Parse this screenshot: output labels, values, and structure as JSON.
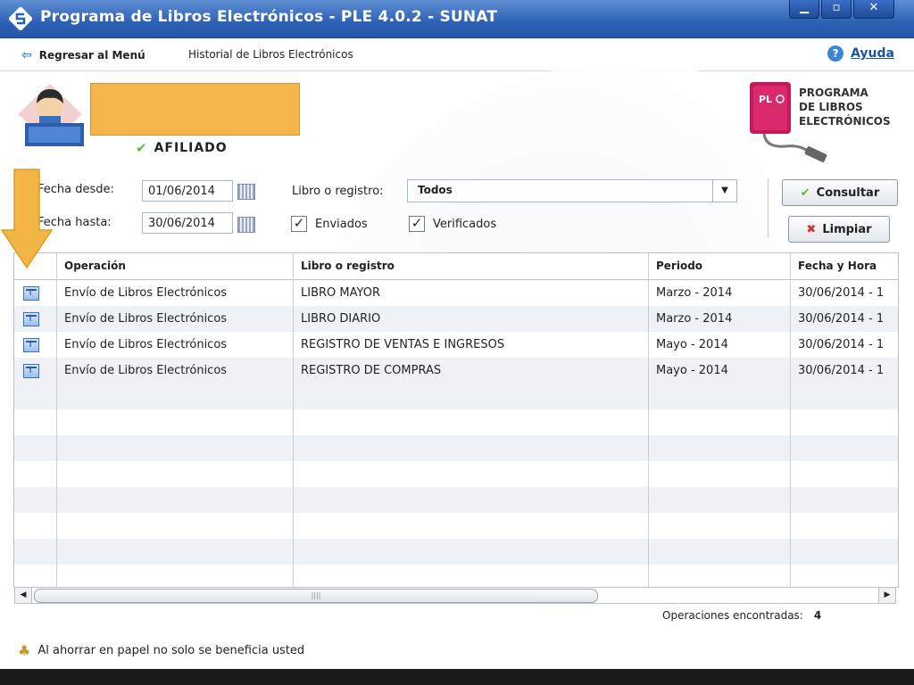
{
  "window": {
    "title": "Programa de Libros Electrónicos - PLE 4.0.2 - SUNAT",
    "minimize": "▁",
    "maximize": "▫",
    "close": "✕"
  },
  "nav": {
    "back_label": "Regresar al Menú",
    "current_label": "Historial de Libros Electrónicos",
    "help_label": "Ayuda"
  },
  "user": {
    "status": "AFILIADO"
  },
  "logo": {
    "line1": "PROGRAMA",
    "line2": "DE LIBROS",
    "line3": "ELECTRÓNICOS",
    "badge": "PL"
  },
  "filters": {
    "fecha_desde_label": "Fecha desde:",
    "fecha_desde": "01/06/2014",
    "fecha_hasta_label": "Fecha hasta:",
    "fecha_hasta": "30/06/2014",
    "libro_label": "Libro o registro:",
    "libro_value": "Todos",
    "enviados_label": "Enviados",
    "verificados_label": "Verificados"
  },
  "buttons": {
    "consultar": "Consultar",
    "limpiar": "Limpiar"
  },
  "table": {
    "columns": [
      "Operación",
      "Libro o registro",
      "Periodo",
      "Fecha y Hora"
    ],
    "rows": [
      {
        "operacion": "Envío de Libros Electrónicos",
        "libro": "LIBRO MAYOR",
        "periodo": "Marzo  -  2014",
        "fecha": "30/06/2014 - 1"
      },
      {
        "operacion": "Envío de Libros Electrónicos",
        "libro": "LIBRO DIARIO",
        "periodo": "Marzo  -  2014",
        "fecha": "30/06/2014 - 1"
      },
      {
        "operacion": "Envío de Libros Electrónicos",
        "libro": "REGISTRO DE VENTAS E INGRESOS",
        "periodo": "Mayo  -  2014",
        "fecha": "30/06/2014 - 1"
      },
      {
        "operacion": "Envío de Libros Electrónicos",
        "libro": "REGISTRO DE COMPRAS",
        "periodo": "Mayo  -  2014",
        "fecha": "30/06/2014 - 1"
      }
    ]
  },
  "status": {
    "found_label": "Operaciones encontradas:",
    "found_count": "4"
  },
  "footer": {
    "message": "Al ahorrar en papel no solo se beneficia usted"
  },
  "colors": {
    "titlebar": "#2d61b3",
    "highlight_box": "#f5b54b",
    "arrow": "#f3b545"
  }
}
